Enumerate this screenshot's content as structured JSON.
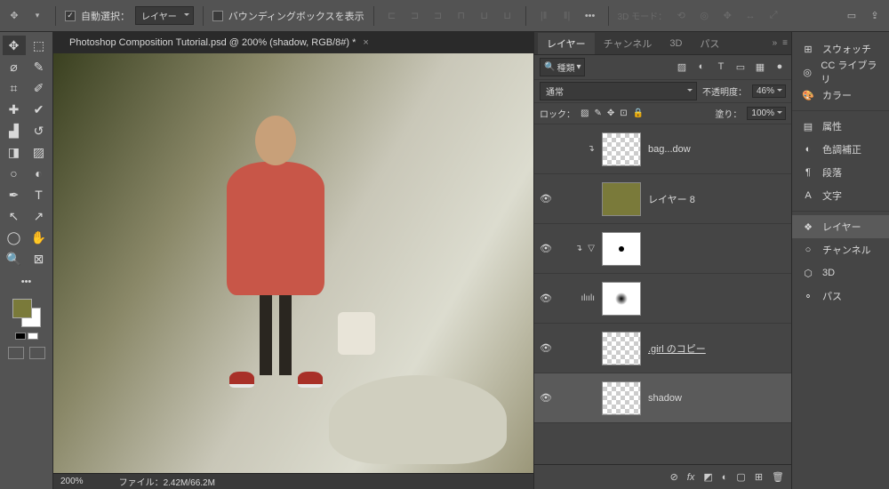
{
  "options": {
    "auto_select": "自動選択：",
    "layer_dropdown": "レイヤー",
    "show_bbox": "バウンディングボックスを表示",
    "mode_3d": "3D モード："
  },
  "document": {
    "tab_title": "Photoshop Composition Tutorial.psd @ 200% (shadow, RGB/8#) *",
    "zoom": "200%",
    "file_stats": "ファイル：2.42M/66.2M"
  },
  "swatch": {
    "fg": "#7a7a3a"
  },
  "panel": {
    "tabs": [
      "レイヤー",
      "チャンネル",
      "3D",
      "パス"
    ],
    "search_label": "種類",
    "blend_mode": "通常",
    "opacity_label": "不透明度：",
    "opacity_val": "46%",
    "lock_label": "ロック：",
    "fill_label": "塗り：",
    "fill_val": "100%"
  },
  "layers": [
    {
      "vis": false,
      "indent_icons": [
        "↴"
      ],
      "thumb": "checker",
      "name": "bag...dow"
    },
    {
      "vis": true,
      "indent_icons": [],
      "thumb": "olive",
      "name": "レイヤー 8"
    },
    {
      "vis": true,
      "indent_icons": [
        "↴",
        "▽"
      ],
      "thumb": "mask",
      "name": ""
    },
    {
      "vis": true,
      "indent_icons": [
        "ılıılı"
      ],
      "thumb": "blur",
      "name": ""
    },
    {
      "vis": true,
      "indent_icons": [],
      "thumb": "checker",
      "name": ".girl のコピー",
      "link": true
    },
    {
      "vis": true,
      "indent_icons": [],
      "thumb": "checker",
      "name": "shadow",
      "active": true
    }
  ],
  "dock": [
    {
      "icon": "⊞",
      "label": "スウォッチ"
    },
    {
      "icon": "◎",
      "label": "CC ライブラリ"
    },
    {
      "icon": "🎨",
      "label": "カラー"
    },
    {
      "sep": true
    },
    {
      "icon": "▤",
      "label": "属性"
    },
    {
      "icon": "◐",
      "label": "色調補正"
    },
    {
      "icon": "¶",
      "label": "段落"
    },
    {
      "icon": "A",
      "label": "文字"
    },
    {
      "sep": true
    },
    {
      "icon": "❖",
      "label": "レイヤー",
      "active": true
    },
    {
      "icon": "○",
      "label": "チャンネル"
    },
    {
      "icon": "⬡",
      "label": "3D"
    },
    {
      "icon": "⚬",
      "label": "パス"
    }
  ]
}
